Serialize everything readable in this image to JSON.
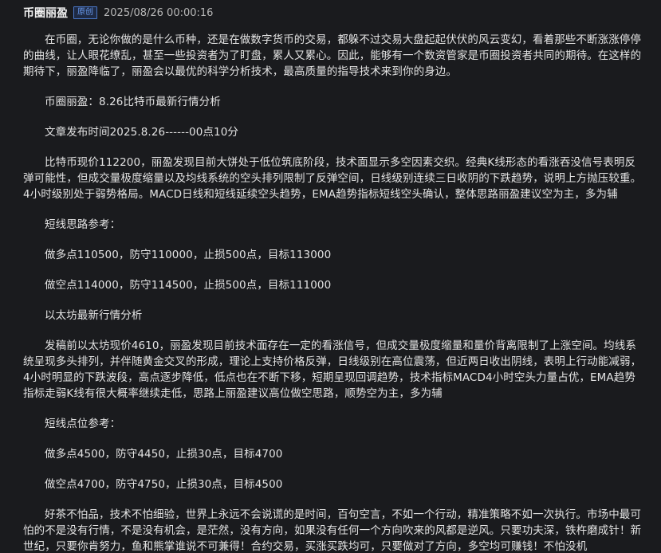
{
  "header": {
    "author": "币圈丽盈",
    "badge": "原创",
    "datetime": "2025/08/26 00:00:16"
  },
  "article": {
    "paragraphs": [
      "在币圈，无论你做的是什么币种，还是在做数字货币的交易，都躲不过交易大盘起起伏伏的风云变幻，看着那些不断涨涨停停的曲线，让人眼花缭乱，甚至一些投资者为了盯盘，累人又累心。因此，能够有一个数资管家是币圈投资者共同的期待。在这样的期待下，丽盈降临了，丽盈会以最优的科学分析技术，最高质量的指导技术来到你的身边。",
      "币圈丽盈：8.26比特币最新行情分析",
      "文章发布时间2025.8.26------00点10分",
      "比特币现价112200，丽盈发现目前大饼处于低位筑底阶段，技术面显示多空因素交织。经典K线形态的看涨吞没信号表明反弹可能性，但成交量极度缩量以及均线系统的空头排列限制了反弹空间，日线级别连续三日收阴的下跌趋势，说明上方抛压较重。4小时级别处于弱势格局。MACD日线和短线延续空头趋势，EMA趋势指标短线空头确认，整体思路丽盈建议空为主，多为辅",
      "短线思路参考：",
      "做多点110500，防守110000，止损500点，目标113000",
      "做空点114000，防守114500，止损500点，目标111000",
      "以太坊最新行情分析",
      "发稿前以太坊现价4610，丽盈发现目前技术面存在一定的看涨信号，但成交量极度缩量和量价背离限制了上涨空间。均线系统呈现多头排列，并伴随黄金交叉的形成，理论上支持价格反弹，日线级别在高位震荡，但近两日收出阴线，表明上行动能减弱，4小时明显的下跌波段，高点逐步降低，低点也在不断下移，短期呈现回调趋势，技术指标MACD4小时空头力量占优，EMA趋势指标走弱K线有很大概率继续走低，思路上丽盈建议高位做空思路，顺势空为主，多为辅",
      "短线点位参考：",
      "做多点4500，防守4450，止损30点，目标4700",
      "做空点4700，防守4750，止损30点，目标4500",
      "好茶不怕品，技术不怕细验，世界上永远不会说谎的是时间，百句空言，不如一个行动，精准策略不如一次执行。市场中最可怕的不是没有行情，不是没有机会，是茫然，没有方向，如果没有任何一个方向吹来的风都是逆风。只要功夫深，铁杵磨成针！新世纪，只要你肯努力，鱼和熊掌谁说不可兼得！合约交易，买涨买跌均可，只要做对了方向，多空均可赚钱！不怕没机"
    ]
  }
}
